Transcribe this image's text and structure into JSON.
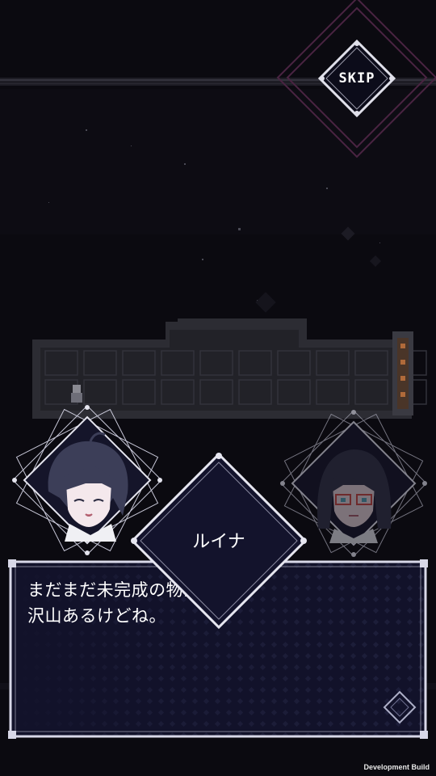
{
  "hud": {
    "skip_label": "SKIP"
  },
  "speaker": {
    "name": "ルイナ"
  },
  "dialog": {
    "text": "まだまだ未完成の物が\n沢山あるけどね。"
  },
  "footer": {
    "build_label": "Development Build"
  },
  "colors": {
    "background": "#0b0a10",
    "panel": "#12122a",
    "frame": "#d8d8e8",
    "accent_magenta": "#5a2a52",
    "floor_tile": "#25252c"
  }
}
